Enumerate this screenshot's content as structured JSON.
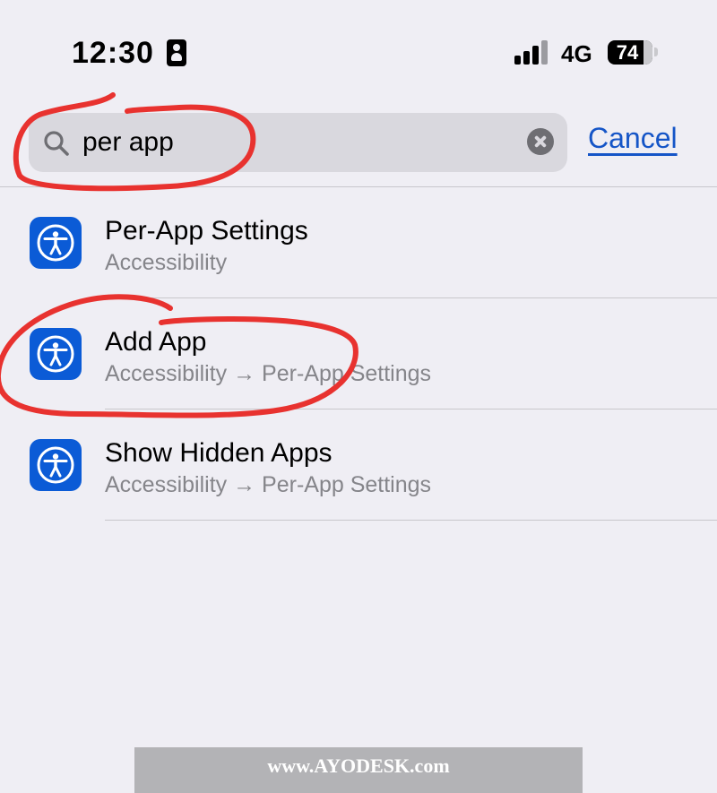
{
  "status_bar": {
    "time": "12:30",
    "network": "4G",
    "battery_level": "74"
  },
  "search": {
    "value": "per app",
    "placeholder": "Search",
    "cancel_label": "Cancel"
  },
  "results": [
    {
      "title": "Per-App Settings",
      "path": "Accessibility",
      "icon": "accessibility-icon"
    },
    {
      "title": "Add App",
      "path": "Accessibility → Per-App Settings",
      "icon": "accessibility-icon"
    },
    {
      "title": "Show Hidden Apps",
      "path": "Accessibility → Per-App Settings",
      "icon": "accessibility-icon"
    }
  ],
  "watermark": {
    "text": "www.AYODESK.com"
  },
  "colors": {
    "background": "#efeef4",
    "accent": "#1555c7",
    "icon_tile": "#0b5bd6",
    "annotation": "#e8322f",
    "secondary_text": "#85858a"
  }
}
